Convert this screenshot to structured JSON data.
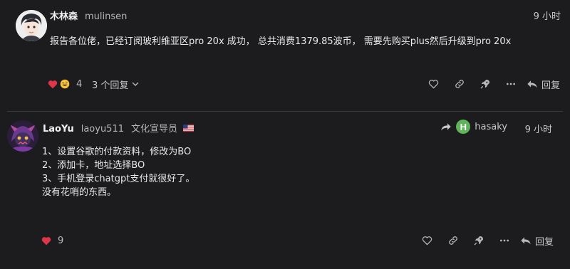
{
  "posts": [
    {
      "display_name": "木林森",
      "username": "mulinsen",
      "time": "9 小时",
      "body_lines": [
        "报告各位佬，已经订阅玻利维亚区pro 20x 成功， 总共消费1379.85波币， 需要先购买plus然后升级到pro 20x"
      ],
      "reactions": [
        "heart",
        "grin"
      ],
      "like_count": "4",
      "replies_label": "3 个回复",
      "reply_label": "回复"
    },
    {
      "display_name": "LaoYu",
      "username": "laoyu511",
      "user_title": "文化宣导员",
      "flag": "us-flag",
      "reply_to_initial": "H",
      "reply_to_user": "hasaky",
      "time": "9 小时",
      "body_lines": [
        "1、设置谷歌的付款资料，修改为BO",
        "2、添加卡，地址选择BO",
        "3、手机登录chatgpt支付就很好了。",
        "没有花哨的东西。"
      ],
      "reactions": [
        "heart"
      ],
      "like_count": "9",
      "reply_label": "回复"
    }
  ],
  "colors": {
    "background": "#1c1c1e",
    "heart": "#e0364a",
    "reply_avatar": "#5fb35a",
    "icon": "#b7b7bb"
  }
}
